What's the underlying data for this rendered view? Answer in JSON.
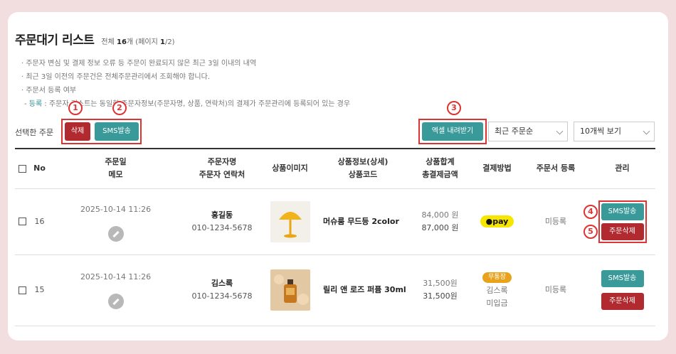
{
  "header": {
    "title": "주문대기 리스트",
    "count_prefix": "전체 ",
    "total": "16",
    "count_mid": "개 (페이지 ",
    "page": "1",
    "count_suffix": "/2)"
  },
  "notes": {
    "line1": "· 주문자 변심 및 결제 정보 오류 등 주문이 완료되지 않은 최근 3일 이내의 내역",
    "line2": "· 최근 3일 이전의 주문건은 전체주문관리에서 조회해야 합니다.",
    "line3": "· 주문서 등록 여부",
    "line4_prefix": "- ",
    "line4_highlight": "등록",
    "line4_rest": " : 주문자 리스트는 동일한 주문자정보(주문자명, 상품, 연락처)의 결제가 주문관리에 등록되어 있는 경우"
  },
  "markers": [
    "1",
    "2",
    "3",
    "4",
    "5"
  ],
  "toolbar": {
    "selected_label": "선택한 주문",
    "delete_label": "삭제",
    "sms_label": "SMS발송",
    "excel_label": "엑셀 내려받기",
    "sort_value": "최근 주문순",
    "page_size_value": "10개씩 보기"
  },
  "table": {
    "headers": {
      "no": "No",
      "date_1": "주문일",
      "date_2": "메모",
      "name_1": "주문자명",
      "name_2": "주문자 연락처",
      "image": "상품이미지",
      "product_1": "상품정보(상세)",
      "product_2": "상품코드",
      "total_1": "상품합계",
      "total_2": "총결제금액",
      "payment": "결제방법",
      "register": "주문서 등록",
      "manage": "관리"
    },
    "rows": [
      {
        "no": "16",
        "date": "2025-10-14 11:26",
        "name": "홍길동",
        "phone": "010-1234-5678",
        "product": "머슈룸 무드등 2color",
        "subtotal": "84,000 원",
        "total": "87,000 원",
        "payment": "●pay",
        "register": "미등록",
        "sms": "SMS발송",
        "delete": "주문삭제"
      },
      {
        "no": "15",
        "date": "2025-10-14 11:26",
        "name": "김스록",
        "phone": "010-1234-5678",
        "product": "릴리 앤 로즈 퍼퓸 30ml",
        "subtotal": "31,500원",
        "total": "31,500원",
        "payment_badge": "무통장",
        "payer": "김스록",
        "pay_status": "미입금",
        "register": "미등록",
        "sms": "SMS발송",
        "delete": "주문삭제"
      }
    ]
  }
}
